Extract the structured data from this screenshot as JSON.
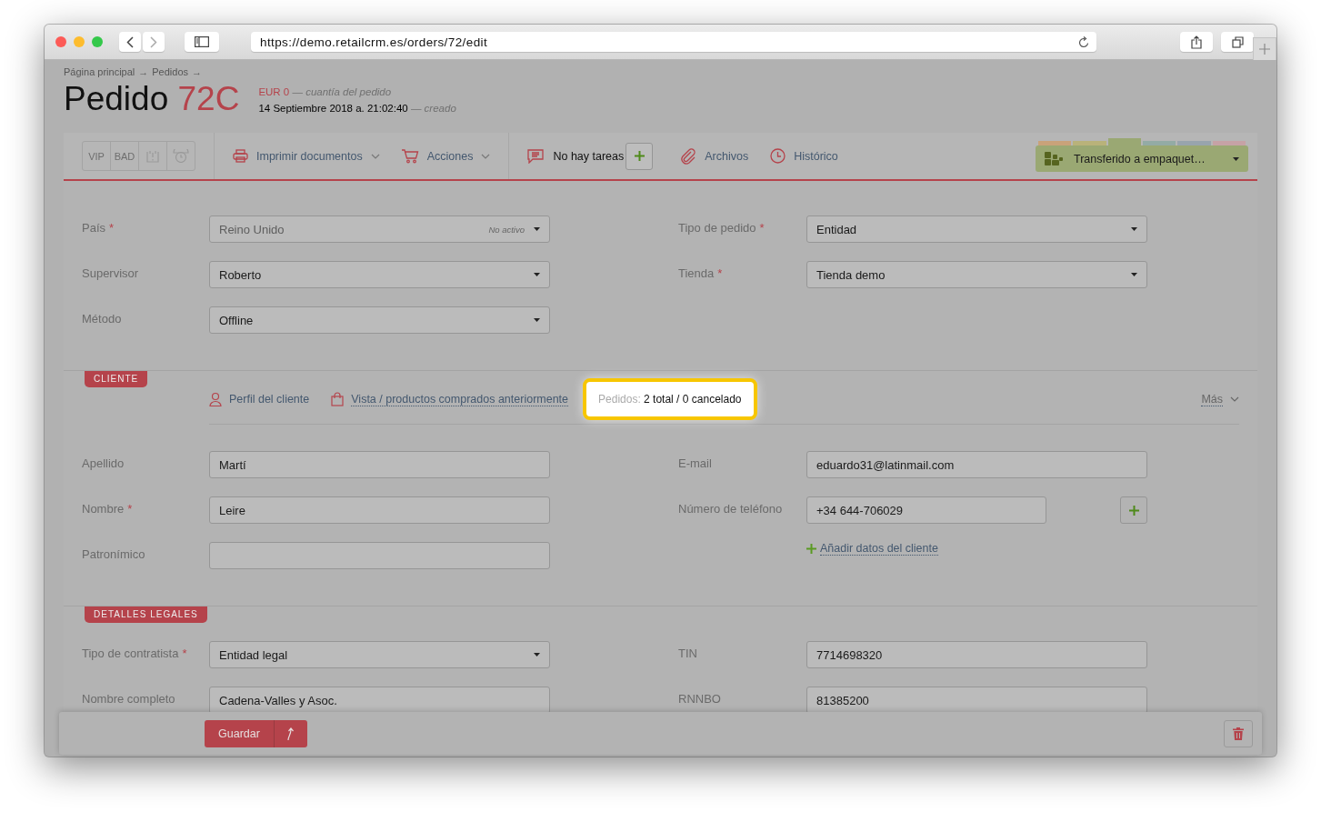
{
  "browser": {
    "url": "https://demo.retailcrm.es/orders/72/edit"
  },
  "breadcrumbs": [
    {
      "label": "Página principal",
      "separator": "→"
    },
    {
      "label": "Pedidos",
      "separator": "→"
    }
  ],
  "order": {
    "title": "Pedido",
    "number": "72C",
    "amount": "EUR 0",
    "amount_note": "— cuantía del pedido",
    "created": "14 Septiembre 2018 a. 21:02:40",
    "created_note": "— creado"
  },
  "toolbar": {
    "flags": [
      {
        "kind": "text",
        "label": "VIP"
      },
      {
        "kind": "text",
        "label": "BAD"
      },
      {
        "kind": "alert"
      },
      {
        "kind": "alarm"
      }
    ],
    "actions": [
      {
        "kind": "print",
        "label": "Imprimir documentos",
        "dropdown": true
      },
      {
        "kind": "cart",
        "label": "Acciones",
        "dropdown": true
      }
    ],
    "tasks": {
      "label": "No hay tareas"
    },
    "links": [
      {
        "kind": "files",
        "label": "Archivos"
      },
      {
        "kind": "history",
        "label": "Histórico"
      }
    ],
    "status": {
      "label": "Transferido a empaquet…",
      "stages": [
        {
          "color": "#c9a27a",
          "selected": false
        },
        {
          "color": "#b9b27a",
          "selected": false
        },
        {
          "color": "#9aa873",
          "selected": true
        },
        {
          "color": "#93aba5",
          "selected": false
        },
        {
          "color": "#98a4ad",
          "selected": false
        },
        {
          "color": "#c6a2a6",
          "selected": false
        }
      ]
    }
  },
  "sections": [
    {
      "rows": [
        {
          "left": {
            "kind": "select",
            "label": "País",
            "required_mark": "*",
            "value": "Reino Unido",
            "hint": "No activo",
            "disabled": true
          },
          "right": {
            "kind": "select",
            "label": "Tipo de pedido",
            "required_mark": "*",
            "value": "Entidad",
            "disabled": false
          }
        },
        {
          "left": {
            "kind": "select",
            "label": "Supervisor",
            "value": "Roberto",
            "disabled": false
          },
          "right": {
            "kind": "select",
            "label": "Tienda",
            "required_mark": "*",
            "value": "Tienda demo",
            "disabled": false
          }
        },
        {
          "left": {
            "kind": "select",
            "label": "Método",
            "value": "Offline",
            "disabled": false
          }
        }
      ]
    },
    {
      "tag": "CLIENTE",
      "links": [
        {
          "kind": "profile",
          "label": "Perfil del cliente",
          "underlined": false
        },
        {
          "kind": "bag",
          "label": "Vista / productos comprados anteriormente",
          "underlined": true
        }
      ],
      "orders_summary": {
        "label": "Pedidos:",
        "value": "2 total / 0 cancelado",
        "highlighted": true
      },
      "more": {
        "label": "Más"
      },
      "rows": [
        {
          "left": {
            "kind": "text",
            "label": "Apellido",
            "value": "Martí"
          },
          "right": {
            "kind": "text",
            "label": "E-mail",
            "value": "eduardo31@latinmail.com"
          }
        },
        {
          "left": {
            "kind": "text",
            "label": "Nombre",
            "required_mark": "*",
            "value": "Leire"
          },
          "right": {
            "kind": "phone",
            "label": "Número de teléfono",
            "value": "+34 644-706029"
          }
        },
        {
          "left": {
            "kind": "text",
            "label": "Patronímico"
          },
          "right": {
            "kind": "link",
            "label": "Añadir datos del cliente"
          }
        }
      ]
    },
    {
      "tag": "DETALLES LEGALES",
      "rows": [
        {
          "left": {
            "kind": "select",
            "label": "Tipo de contratista",
            "required_mark": "*",
            "value": "Entidad legal",
            "disabled": false
          },
          "right": {
            "kind": "text",
            "label": "TIN",
            "value": "7714698320"
          }
        },
        {
          "left": {
            "kind": "text",
            "label": "Nombre completo",
            "value": "Cadena-Valles y Asoc."
          },
          "right": {
            "kind": "text",
            "label": "RNNBO",
            "value": "81385200"
          }
        }
      ]
    }
  ],
  "footer": {
    "save": {
      "label": "Guardar"
    }
  }
}
